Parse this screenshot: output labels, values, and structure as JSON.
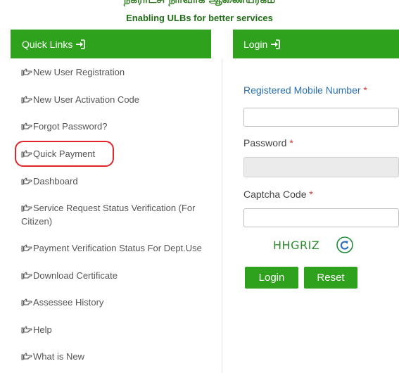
{
  "header": {
    "title_tamil": "நகராட்சி நிர்வாக ஆணையரகம்",
    "tagline": "Enabling ULBs for better services"
  },
  "quick_links": {
    "title": "Quick Links",
    "items": [
      {
        "label": "New User Registration"
      },
      {
        "label": "New User Activation Code"
      },
      {
        "label": "Forgot Password?"
      },
      {
        "label": "Quick Payment"
      },
      {
        "label": "Dashboard"
      },
      {
        "label": "Service Request Status Verification (For Citizen)"
      },
      {
        "label": "Payment Verification Status For Dept.Use"
      },
      {
        "label": "Download Certificate"
      },
      {
        "label": "Assessee History"
      },
      {
        "label": "Help"
      },
      {
        "label": "What is New"
      }
    ]
  },
  "login": {
    "title": "Login",
    "mobile_label": "Registered Mobile Number",
    "mobile_value": "",
    "password_label": "Password",
    "password_value": "",
    "captcha_label": "Captcha Code",
    "captcha_value": "",
    "captcha_text": "HHGRIZ",
    "required_mark": "*",
    "login_button": "Login",
    "reset_button": "Reset"
  },
  "colors": {
    "brand_green": "#2ea11d",
    "highlight_red": "#e0252a",
    "label_blue": "#2a6fb0"
  }
}
